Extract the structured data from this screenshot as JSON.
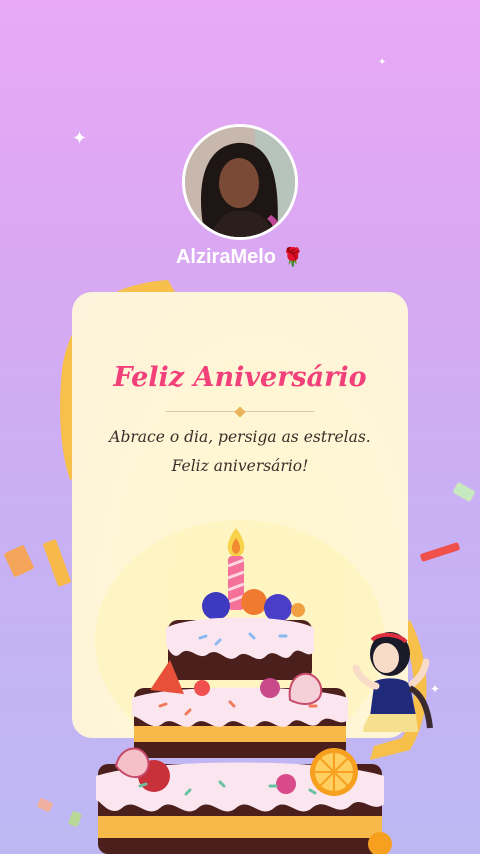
{
  "profile": {
    "username": "AlziraMelo",
    "badge_emoji": "🌹"
  },
  "card": {
    "title": "Feliz Aniversário",
    "message": "Abrace o dia, persiga as estrelas. Feliz aniversário!"
  },
  "colors": {
    "title": "#f2407a",
    "background_top": "#e9a9f5",
    "background_bottom": "#bdb8f3",
    "card": "#fff6d6",
    "ribbon": "#f7c04a"
  },
  "icons": {
    "badge": "rose-icon",
    "sparkle": "sparkle-icon"
  }
}
